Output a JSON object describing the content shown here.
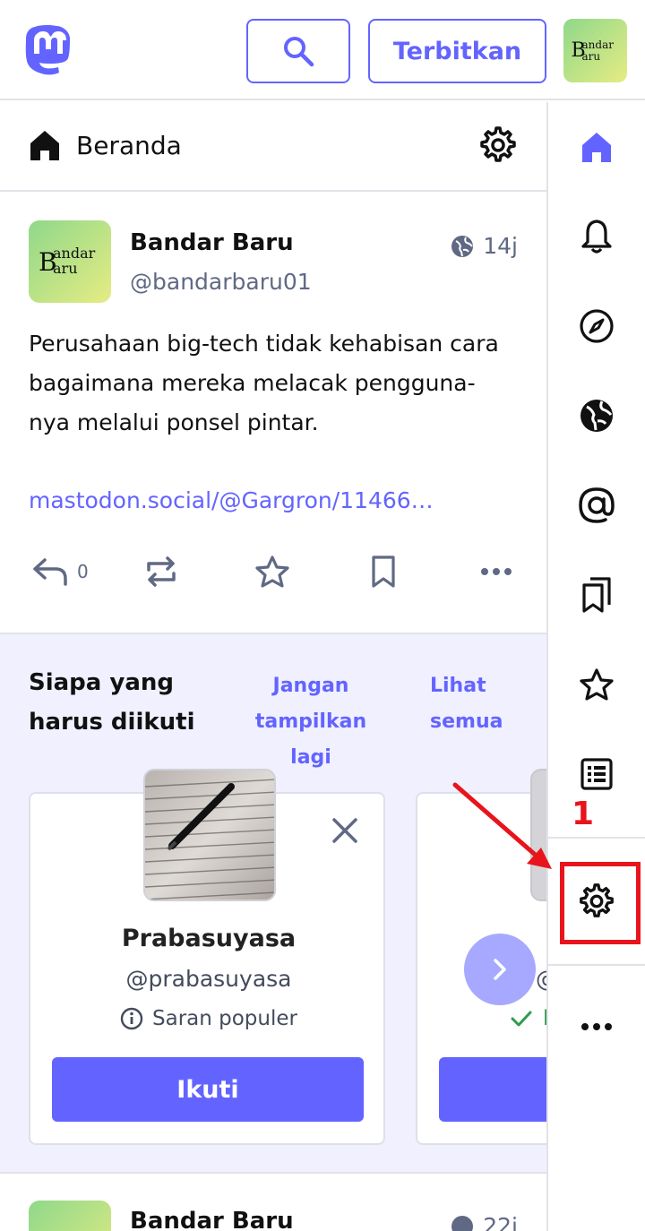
{
  "topbar": {
    "publish_label": "Terbitkan",
    "avatar_line1": "andar",
    "avatar_line2": "aru",
    "avatar_initial": "B"
  },
  "column": {
    "title": "Beranda"
  },
  "post1": {
    "author_name": "Bandar Baru",
    "author_handle": "@bandarbaru01",
    "time": "14j",
    "body": "Perusahaan big-tech tidak kehabisan cara bagaimana mereka melacak pengguna-nya melalui ponsel pintar.",
    "link": "mastodon.social/@Gargron/11466…",
    "reply_count": "0"
  },
  "suggestions": {
    "title": "Siapa yang harus diikuti",
    "dismiss_label": "Jangan tampilkan lagi",
    "see_all_label": "Lihat semua",
    "card1": {
      "name": "Prabasuyasa",
      "handle": "@prabasuyasa",
      "reason": "Saran populer",
      "follow_label": "Ikuti"
    },
    "card2": {
      "handle_partial": "@",
      "reason_partial": "l"
    }
  },
  "post2": {
    "author_name": "Bandar Baru",
    "time": "22j"
  },
  "nav": {
    "items": [
      "home-icon",
      "bell-icon",
      "compass-icon",
      "globe-icon",
      "at-icon",
      "bookmarks-icon",
      "star-icon",
      "list-icon",
      "gear-icon",
      "more-icon"
    ]
  },
  "annotation": {
    "number": "1",
    "color": "#e8141c"
  },
  "colors": {
    "accent": "#6364ff",
    "muted": "#606984",
    "suggestion_bg": "#f0f0ff"
  }
}
